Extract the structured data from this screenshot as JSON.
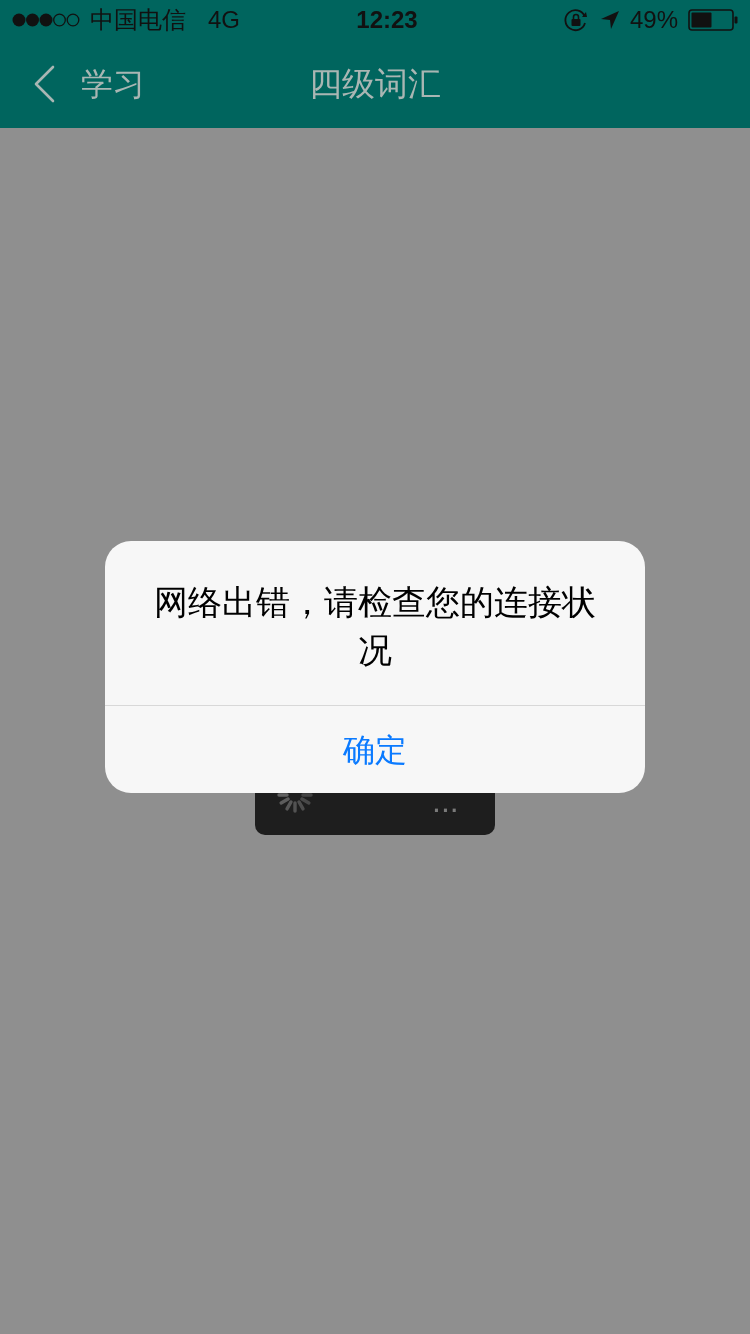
{
  "status_bar": {
    "carrier": "中国电信",
    "network": "4G",
    "time": "12:23",
    "battery": "49%"
  },
  "nav_bar": {
    "back_label": "学习",
    "title": "四级词汇"
  },
  "loading_toast": {
    "text": "..."
  },
  "alert": {
    "message": "网络出错，请检查您的连接状况",
    "buttons": [
      "确定"
    ]
  }
}
